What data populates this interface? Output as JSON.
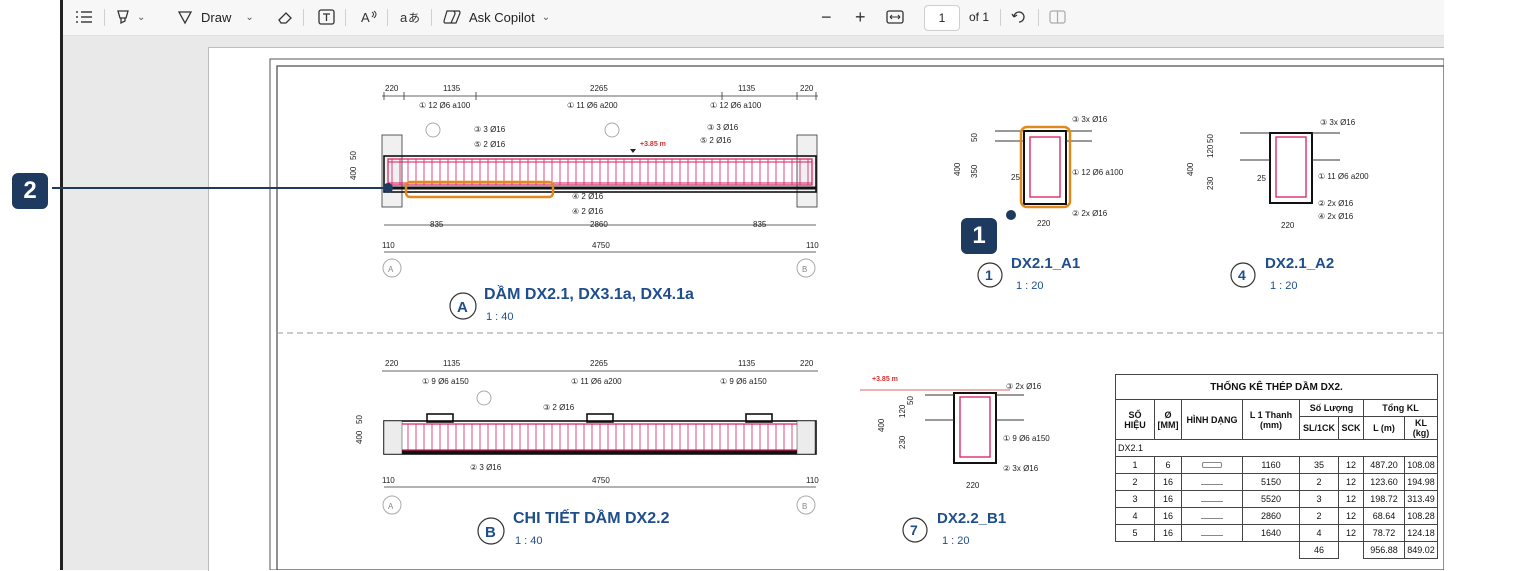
{
  "toolbar": {
    "draw_label": "Draw",
    "copilot_label": "Ask Copilot",
    "page_current": "1",
    "page_of": "of 1"
  },
  "callouts": {
    "one": "1",
    "two": "2"
  },
  "drawing": {
    "beam_a": {
      "title": "DẦM DX2.1, DX3.1a, DX4.1a",
      "scale": "1 : 40",
      "circle": "A",
      "top_dims": [
        "220",
        "1135",
        "2265",
        "1135",
        "220"
      ],
      "stirrups": [
        "① 12 Ø6 a100",
        "① 11 Ø6 a200",
        "① 12 Ø6 a100"
      ],
      "bar_labels": [
        "③ 3 Ø16",
        "⑤ 2 Ø16",
        "③ 3 Ø16",
        "⑤ 2 Ø16",
        "④ 2 Ø16",
        "④ 2 Ø16"
      ],
      "bottom_dims": [
        "835",
        "2860",
        "835"
      ],
      "span_dims": [
        "110",
        "4750",
        "110"
      ],
      "level": "+3.85 m",
      "axis_left": "A",
      "axis_right": "B",
      "height_dims": [
        "50",
        "400"
      ]
    },
    "section_a1": {
      "title": "DX2.1_A1",
      "scale": "1 : 20",
      "circle": "1",
      "labels": [
        "③ 3x Ø16",
        "① 12 Ø6 a100",
        "② 2x Ø16"
      ],
      "dims": [
        "50",
        "400",
        "350",
        "25",
        "220"
      ]
    },
    "section_a2": {
      "title": "DX2.1_A2",
      "scale": "1 : 20",
      "circle": "4",
      "labels": [
        "③ 3x Ø16",
        "① 11 Ø6 a200",
        "② 2x Ø16",
        "④ 2x Ø16"
      ],
      "dims": [
        "50",
        "120",
        "400",
        "230",
        "25",
        "220"
      ]
    },
    "beam_b": {
      "title": "CHI TIẾT DẦM DX2.2",
      "scale": "1 : 40",
      "circle": "B",
      "top_dims": [
        "220",
        "1135",
        "2265",
        "1135",
        "220"
      ],
      "stirrups": [
        "① 9 Ø6 a150",
        "① 11 Ø6 a200",
        "① 9 Ø6 a150"
      ],
      "bar_labels": [
        "③ 2 Ø16",
        "② 3 Ø16"
      ],
      "span_dims": [
        "110",
        "4750",
        "110"
      ],
      "axis_left": "A",
      "axis_right": "B",
      "height_dims": [
        "50",
        "400"
      ]
    },
    "section_b1": {
      "title": "DX2.2_B1",
      "scale": "1 : 20",
      "circle": "7",
      "labels": [
        "③ 2x Ø16",
        "① 9 Ø6 a150",
        "② 3x Ø16"
      ],
      "dims": [
        "120",
        "50",
        "400",
        "230",
        "220"
      ],
      "level": "+3.85 m"
    },
    "table": {
      "title": "THỐNG KÊ THÉP DẦM DX2.",
      "headers": {
        "so_hieu": "SỐ HIỆU",
        "phi": "Ø [MM]",
        "hinh_dang": "HÌNH DẠNG",
        "l1": "L 1 Thanh (mm)",
        "so_luong": "Số Lượng",
        "sl_1ck": "SL/1CK",
        "sck": "SCK",
        "tong_kl": "Tổng KL",
        "l_m": "L (m)",
        "kl": "KL (kg)"
      },
      "group": "DX2.1",
      "rows": [
        [
          "1",
          "6",
          "1160",
          "35",
          "12",
          "487.20",
          "108.08"
        ],
        [
          "2",
          "16",
          "5150",
          "2",
          "12",
          "123.60",
          "194.98"
        ],
        [
          "3",
          "16",
          "5520",
          "3",
          "12",
          "198.72",
          "313.49"
        ],
        [
          "4",
          "16",
          "2860",
          "2",
          "12",
          "68.64",
          "108.28"
        ],
        [
          "5",
          "16",
          "1640",
          "4",
          "12",
          "78.72",
          "124.18"
        ]
      ],
      "totals": [
        "46",
        "956.88",
        "849.02"
      ]
    }
  },
  "colors": {
    "callout_bg": "#1f3a5f",
    "highlight": "#e08a1e",
    "rebar": "#d81b60",
    "title_blue": "#1f4e8c"
  }
}
